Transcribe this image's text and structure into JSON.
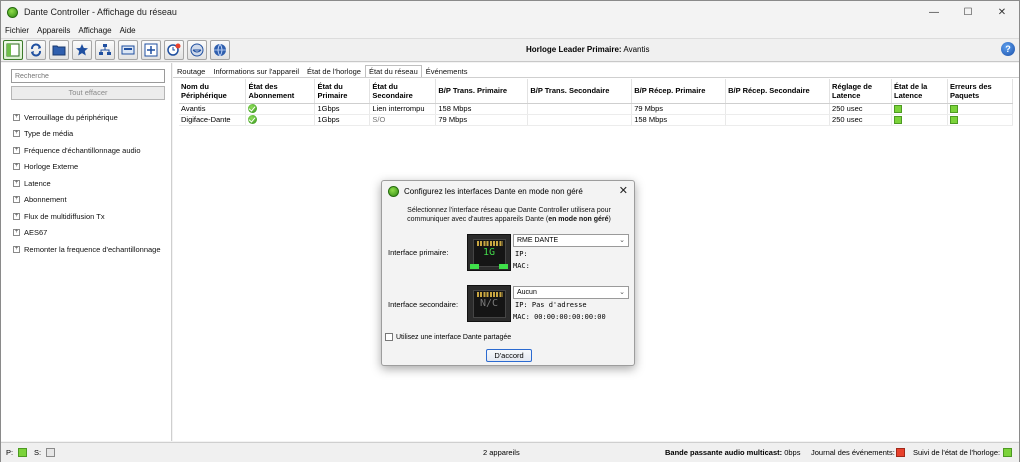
{
  "window": {
    "title": "Dante Controller - Affichage du réseau",
    "controls": [
      "—",
      "☐",
      "✕"
    ]
  },
  "menu": [
    "Fichier",
    "Appareils",
    "Affichage",
    "Aide"
  ],
  "toolbar": {
    "clock_label": "Horloge Leader Primaire:",
    "clock_value": "Avantis",
    "help": "?"
  },
  "sidebar": {
    "search_placeholder": "Recherche",
    "clear_button": "Tout effacer",
    "filters": [
      "Verrouillage du périphérique",
      "Type de média",
      "Fréquence d'échantillonnage audio",
      "Horloge Externe",
      "Latence",
      "Abonnement",
      "Flux de multidiffusion Tx",
      "AES67",
      "Remonter la frequence d'echantillonnage"
    ]
  },
  "tabs": [
    "Routage",
    "Informations sur l'appareil",
    "État de l'horloge",
    "État du réseau",
    "Événements"
  ],
  "active_tab": "État du réseau",
  "table": {
    "columns": [
      "Nom du Périphérique",
      "État des Abonnement",
      "État du Primaire",
      "État du Secondaire",
      "B/P Trans. Primaire",
      "B/P Trans. Secondaire",
      "B/P Récep. Primaire",
      "B/P Récep. Secondaire",
      "Réglage de Latence",
      "État de la Latence",
      "Erreurs des Paquets"
    ],
    "rows": [
      {
        "name": "Avantis",
        "sub": "ok",
        "primary": "1Gbps",
        "secondary": "Lien interrompu",
        "tx1": "158 Mbps",
        "tx2": "",
        "rx1": "79 Mbps",
        "rx2": "",
        "latency": "250 usec",
        "lat_state": "green",
        "errors": "green"
      },
      {
        "name": "Digiface-Dante",
        "sub": "ok",
        "primary": "1Gbps",
        "secondary": "S/O",
        "tx1": "79 Mbps",
        "tx2": "",
        "rx1": "158 Mbps",
        "rx2": "",
        "latency": "250 usec",
        "lat_state": "green",
        "errors": "green"
      }
    ]
  },
  "dialog": {
    "title": "Configurez les interfaces Dante en mode non géré",
    "desc_line1": "Sélectionnez l'interface réseau que Dante Controller utilisera pour",
    "desc_line2": "communiquer avec d'autres appareils Dante (",
    "desc_bold": "en mode non géré",
    "desc_end": ")",
    "primary_label": "Interface primaire:",
    "primary_speed": "1G",
    "primary_select": "RME DANTE",
    "primary_ip": "IP:",
    "primary_mac": "MAC:",
    "secondary_label": "Interface secondaire:",
    "secondary_speed": "N/C",
    "secondary_select": "Aucun",
    "secondary_ip": "IP: Pas d'adresse",
    "secondary_mac": "MAC: 00:00:00:00:00:00",
    "checkbox_label": "Utilisez une interface Dante partagée",
    "ok_button": "D'accord"
  },
  "statusbar": {
    "p_label": "P:",
    "s_label": "S:",
    "device_count": "2 appareils",
    "multicast_label": "Bande passante audio multicast:",
    "multicast_value": "0bps",
    "events_label": "Journal des événements:",
    "clock_status_label": "Suivi de l'état de l'horloge:"
  },
  "colors": {
    "ok_green": "#7bd33a",
    "event_red": "#e8412c",
    "accent_blue": "#2b6ad0"
  }
}
